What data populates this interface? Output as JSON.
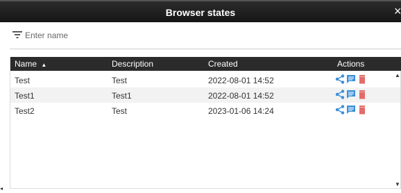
{
  "window": {
    "title": "Browser states"
  },
  "filter": {
    "placeholder": "Enter name",
    "value": ""
  },
  "table": {
    "columns": [
      {
        "label": "Name",
        "sorted": "asc"
      },
      {
        "label": "Description"
      },
      {
        "label": "Created"
      },
      {
        "label": "Actions"
      }
    ],
    "rows": [
      {
        "name": "Test",
        "description": "Test",
        "created": "2022-08-01 14:52"
      },
      {
        "name": "Test1",
        "description": "Test1",
        "created": "2022-08-01 14:52"
      },
      {
        "name": "Test2",
        "description": "Test",
        "created": "2023-01-06 14:24"
      }
    ]
  },
  "icons": {
    "sort": "sort-asc-icon",
    "share": "share-icon",
    "comment": "comment-icon",
    "delete": "trash-icon",
    "filter": "filter-icon",
    "close": "close-icon"
  },
  "colors": {
    "header_bg": "#2b2b2b",
    "share": "#3a8ed8",
    "comment": "#3a8ed8",
    "delete": "#e26b6b"
  }
}
